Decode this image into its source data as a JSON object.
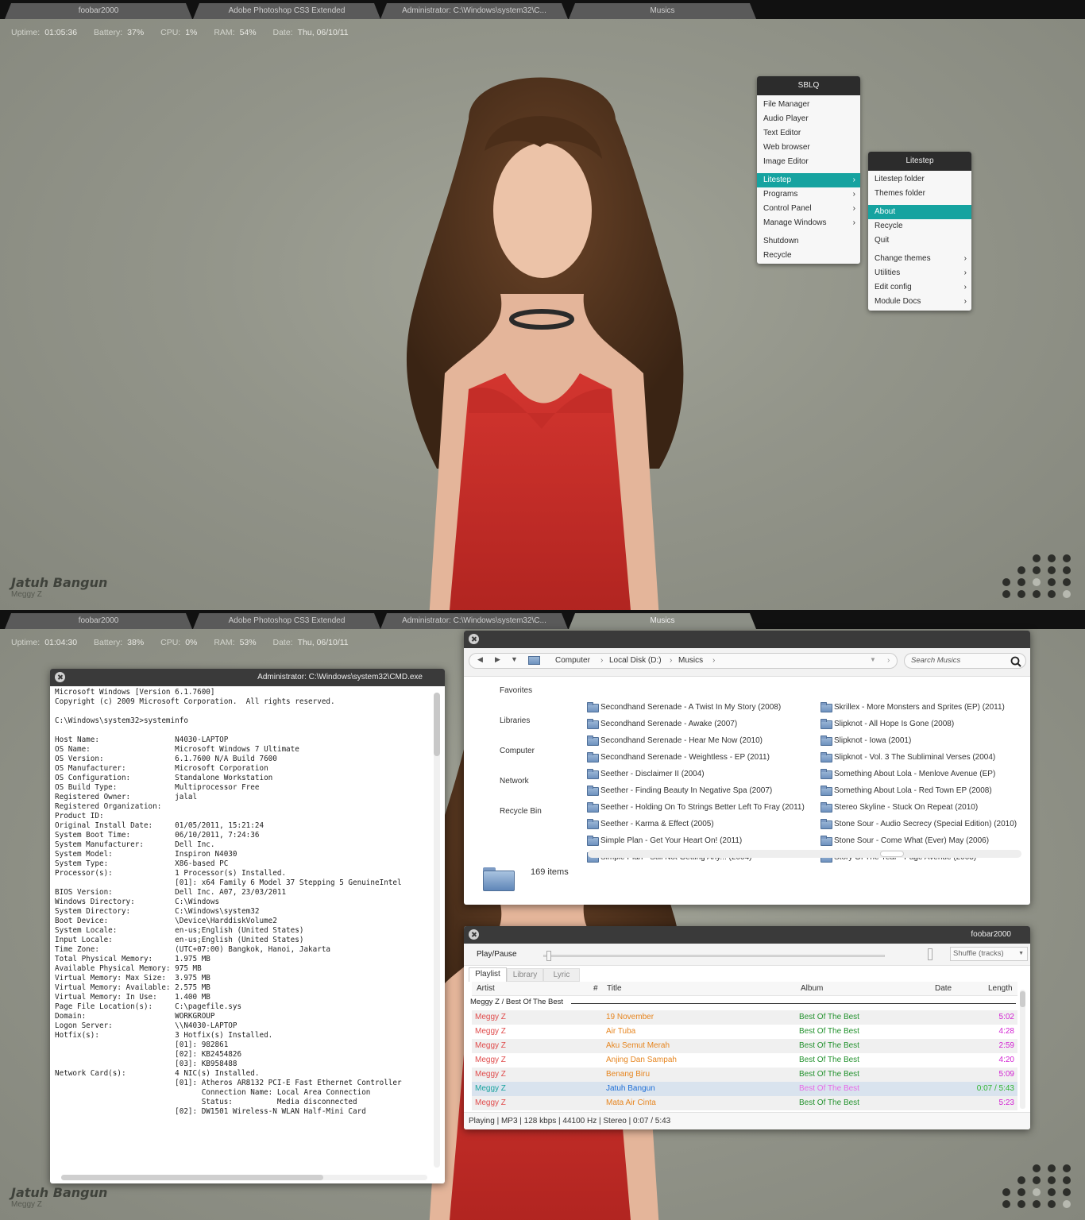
{
  "taskbar_tabs": [
    "foobar2000",
    "Adobe Photoshop CS3 Extended",
    "Administrator: C:\\Windows\\system32\\C...",
    "Musics"
  ],
  "status_top": {
    "uptime_label": "Uptime:",
    "uptime": "01:05:36",
    "battery_label": "Battery:",
    "battery": "37%",
    "cpu_label": "CPU:",
    "cpu": "1%",
    "ram_label": "RAM:",
    "ram": "54%",
    "date_label": "Date:",
    "date": "Thu, 06/10/11"
  },
  "status_bottom": {
    "uptime_label": "Uptime:",
    "uptime": "01:04:30",
    "battery_label": "Battery:",
    "battery": "38%",
    "cpu_label": "CPU:",
    "cpu": "0%",
    "ram_label": "RAM:",
    "ram": "53%",
    "date_label": "Date:",
    "date": "Thu, 06/10/11"
  },
  "now_playing": {
    "title": "Jatuh Bangun",
    "artist": "Meggy Z"
  },
  "sblq_menu": {
    "title": "SBLQ",
    "group1": [
      "File Manager",
      "Audio Player",
      "Text Editor",
      "Web browser",
      "Image Editor"
    ],
    "group2": [
      "Litestep",
      "Programs",
      "Control Panel",
      "Manage Windows"
    ],
    "group3": [
      "Shutdown",
      "Recycle"
    ]
  },
  "litestep_menu": {
    "title": "Litestep",
    "group1": [
      "Litestep folder",
      "Themes folder"
    ],
    "group2": [
      "About",
      "Recycle",
      "Quit"
    ],
    "group3": [
      "Change themes",
      "Utilities",
      "Edit config",
      "Module Docs"
    ]
  },
  "cmd": {
    "title": "Administrator: C:\\Windows\\system32\\CMD.exe",
    "lines": [
      "Microsoft Windows [Version 6.1.7600]",
      "Copyright (c) 2009 Microsoft Corporation.  All rights reserved.",
      "",
      "C:\\Windows\\system32>systeminfo",
      "",
      "Host Name:                 N4030-LAPTOP",
      "OS Name:                   Microsoft Windows 7 Ultimate",
      "OS Version:                6.1.7600 N/A Build 7600",
      "OS Manufacturer:           Microsoft Corporation",
      "OS Configuration:          Standalone Workstation",
      "OS Build Type:             Multiprocessor Free",
      "Registered Owner:          jalal",
      "Registered Organization:",
      "Product ID:",
      "Original Install Date:     01/05/2011, 15:21:24",
      "System Boot Time:          06/10/2011, 7:24:36",
      "System Manufacturer:       Dell Inc.",
      "System Model:              Inspiron N4030",
      "System Type:               X86-based PC",
      "Processor(s):              1 Processor(s) Installed.",
      "                           [01]: x64 Family 6 Model 37 Stepping 5 GenuineIntel",
      "BIOS Version:              Dell Inc. A07, 23/03/2011",
      "Windows Directory:         C:\\Windows",
      "System Directory:          C:\\Windows\\system32",
      "Boot Device:               \\Device\\HarddiskVolume2",
      "System Locale:             en-us;English (United States)",
      "Input Locale:              en-us;English (United States)",
      "Time Zone:                 (UTC+07:00) Bangkok, Hanoi, Jakarta",
      "Total Physical Memory:     1.975 MB",
      "Available Physical Memory: 975 MB",
      "Virtual Memory: Max Size:  3.975 MB",
      "Virtual Memory: Available: 2.575 MB",
      "Virtual Memory: In Use:    1.400 MB",
      "Page File Location(s):     C:\\pagefile.sys",
      "Domain:                    WORKGROUP",
      "Logon Server:              \\\\N4030-LAPTOP",
      "Hotfix(s):                 3 Hotfix(s) Installed.",
      "                           [01]: 982861",
      "                           [02]: KB2454826",
      "                           [03]: KB958488",
      "Network Card(s):           4 NIC(s) Installed.",
      "                           [01]: Atheros AR8132 PCI-E Fast Ethernet Controller",
      "                                 Connection Name: Local Area Connection",
      "                                 Status:          Media disconnected",
      "                           [02]: DW1501 Wireless-N WLAN Half-Mini Card"
    ]
  },
  "explorer": {
    "breadcrumb": [
      "Computer",
      "Local Disk (D:)",
      "Musics"
    ],
    "search_placeholder": "Search Musics",
    "nav": [
      "Favorites",
      "Libraries",
      "Computer",
      "Network",
      "Recycle Bin"
    ],
    "folders_col1": [
      "Secondhand Serenade - A Twist In My Story (2008)",
      "Secondhand Serenade - Awake (2007)",
      "Secondhand Serenade - Hear Me Now (2010)",
      "Secondhand Serenade - Weightless - EP (2011)",
      "Seether - Disclaimer II (2004)",
      "Seether - Finding Beauty In Negative Spa (2007)",
      "Seether - Holding On To Strings Better Left To Fray (2011)",
      "Seether - Karma & Effect (2005)",
      "Simple Plan - Get Your Heart On! (2011)",
      "Simple Plan - Still Not Getting Any... (2004)"
    ],
    "folders_col2": [
      "Skrillex - More Monsters and Sprites (EP) (2011)",
      "Slipknot - All Hope Is Gone (2008)",
      "Slipknot - Iowa (2001)",
      "Slipknot - Vol. 3 The Subliminal Verses (2004)",
      "Something About Lola - Menlove Avenue (EP)",
      "Something About Lola - Red Town EP (2008)",
      "Stereo Skyline - Stuck On Repeat (2010)",
      "Stone Sour - Audio Secrecy (Special Edition) (2010)",
      "Stone Sour - Come What (Ever) May (2006)",
      "Story Of The Year - Page Avenue (2003)"
    ],
    "item_count": "169 items"
  },
  "foobar": {
    "title": "foobar2000",
    "play_pause": "Play/Pause",
    "order": "Shuffle (tracks)",
    "tabs": [
      "Playlist",
      "Library",
      "Lyric"
    ],
    "columns": {
      "artist": "Artist",
      "num": "#",
      "title": "Title",
      "album": "Album",
      "date": "Date",
      "length": "Length"
    },
    "group": "Meggy Z / Best Of The Best",
    "tracks": [
      {
        "artist": "Meggy Z",
        "title": "19 November",
        "album": "Best Of The Best",
        "length": "5:02"
      },
      {
        "artist": "Meggy Z",
        "title": "Air Tuba",
        "album": "Best Of The Best",
        "length": "4:28"
      },
      {
        "artist": "Meggy Z",
        "title": "Aku Semut Merah",
        "album": "Best Of The Best",
        "length": "2:59"
      },
      {
        "artist": "Meggy Z",
        "title": "Anjing Dan Sampah",
        "album": "Best Of The Best",
        "length": "4:20"
      },
      {
        "artist": "Meggy Z",
        "title": "Benang Biru",
        "album": "Best Of The Best",
        "length": "5:09"
      },
      {
        "artist": "Meggy Z",
        "title": "Jatuh Bangun",
        "album": "Best Of The Best",
        "length": "0:07 / 5:43"
      },
      {
        "artist": "Meggy Z",
        "title": "Mata Air Cinta",
        "album": "Best Of The Best",
        "length": "5:23"
      }
    ],
    "status": "Playing | MP3 | 128 kbps | 44100 Hz | Stereo | 0:07 / 5:43"
  },
  "colors": {
    "accent": "#16a3a0",
    "artist": "#e04b4b",
    "title": "#e6851f",
    "album": "#23922e",
    "length": "#d21fd2",
    "now_artist": "#1aa39f",
    "now_title": "#1f6fd6",
    "now_album": "#e86be8",
    "now_length": "#2fb52f"
  }
}
